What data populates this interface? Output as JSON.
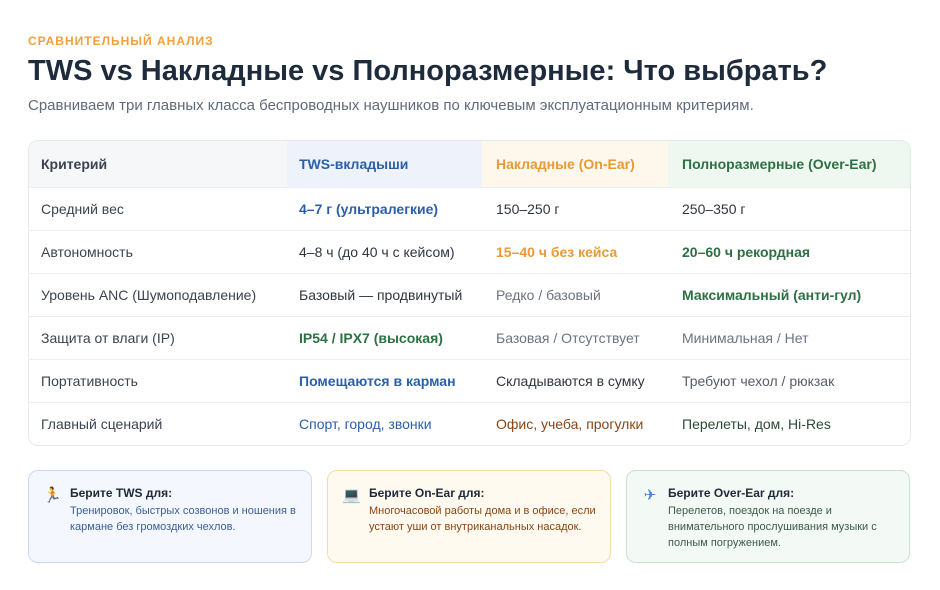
{
  "header": {
    "eyebrow": "СРАВНИТЕЛЬНЫЙ АНАЛИЗ",
    "title": "TWS vs Накладные vs Полноразмерные: Что выбрать?",
    "subtitle": "Сравниваем три главных класса беспроводных наушников по ключевым эксплуатационным критериям."
  },
  "table": {
    "headers": [
      "Критерий",
      "TWS-вкладыши",
      "Накладные (On-Ear)",
      "Полноразмерные (Over-Ear)"
    ],
    "rows": [
      [
        "Средний вес",
        "4–7 г (ультралегкие)",
        "150–250 г",
        "250–350 г"
      ],
      [
        "Автономность",
        "4–8 ч (до 40 ч с кейсом)",
        "15–40 ч без кейса",
        "20–60 ч рекордная"
      ],
      [
        "Уровень ANC (Шумоподавление)",
        "Базовый — продвинутый",
        "Редко / базовый",
        "Максимальный (анти-гул)"
      ],
      [
        "Защита от влаги (IP)",
        "IP54 / IPX7 (высокая)",
        "Базовая / Отсутствует",
        "Минимальная / Нет"
      ],
      [
        "Портативность",
        "Помещаются в карман",
        "Складываются в сумку",
        "Требуют чехол / рюкзак"
      ],
      [
        "Главный сценарий",
        "Спорт, город, звонки",
        "Офис, учеба, прогулки",
        "Перелеты, дом, Hi-Res"
      ]
    ]
  },
  "cards": [
    {
      "icon": "running-icon",
      "glyph": "🏃",
      "title": "Берите TWS для:",
      "body": "Тренировок, быстрых созвонов и ношения в кармане без громоздких чехлов."
    },
    {
      "icon": "laptop-icon",
      "glyph": "💻",
      "title": "Берите On-Ear для:",
      "body": "Многочасовой работы дома и в офисе, если устают уши от внутриканальных насадок."
    },
    {
      "icon": "airplane-icon",
      "glyph": "✈",
      "title": "Берите Over-Ear для:",
      "body": "Перелетов, поездок на поезде и внимательного прослушивания музыки с полным погружением."
    }
  ],
  "colors": {
    "accent_orange": "#f0a03c",
    "tws_blue": "#2b5fa8",
    "onear_orange": "#e79a35",
    "overear_green": "#2d7043"
  }
}
